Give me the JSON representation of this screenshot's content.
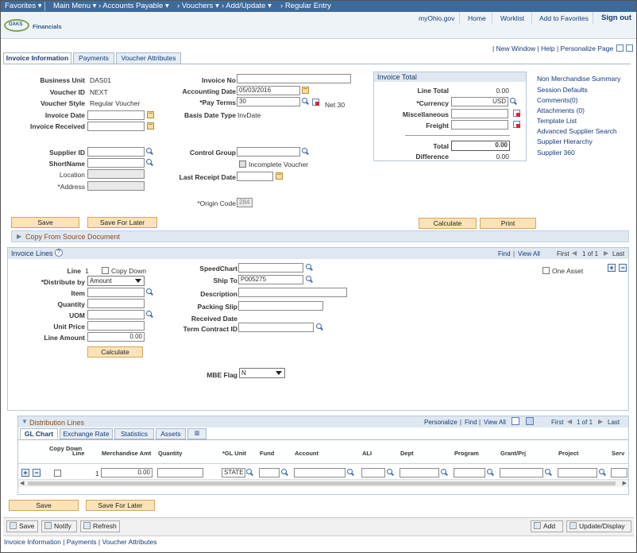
{
  "topnav": {
    "favorites": "Favorites",
    "main_menu": "Main Menu",
    "accounts_payable": "Accounts Payable",
    "vouchers": "Vouchers",
    "add_update": "Add/Update",
    "regular_entry": "Regular Entry"
  },
  "header": {
    "links": [
      "myOhio.gov",
      "Home",
      "Worklist",
      "Add to Favorites",
      "Sign out"
    ],
    "logo_text": "OAKS",
    "logo_sub": "Financials"
  },
  "pagebar": {
    "new_window": "New Window",
    "help": "Help",
    "personalize_page": "Personalize Page"
  },
  "tabs": [
    "Invoice Information",
    "Payments",
    "Voucher Attributes"
  ],
  "header_fields": {
    "business_unit_label": "Business Unit",
    "business_unit": "DAS01",
    "voucher_id_label": "Voucher ID",
    "voucher_id": "NEXT",
    "voucher_style_label": "Voucher Style",
    "voucher_style": "Regular Voucher",
    "invoice_date_label": "Invoice Date",
    "invoice_received_label": "Invoice Received",
    "supplier_id_label": "Supplier ID",
    "shortname_label": "ShortName",
    "location_label": "Location",
    "address_label": "*Address",
    "invoice_no_label": "Invoice No",
    "accounting_date_label": "Accounting Date",
    "accounting_date": "05/03/2016",
    "pay_terms_label": "*Pay Terms",
    "pay_terms": "30",
    "pay_terms_desc": "Net 30",
    "basis_date_type_label": "Basis Date Type",
    "basis_date_type": "InvDate",
    "control_group_label": "Control Group",
    "incomplete_voucher_label": "Incomplete Voucher",
    "last_receipt_date_label": "Last Receipt Date",
    "origin_code_label": "*Origin Code",
    "origin_code": "284"
  },
  "invoice_total": {
    "title": "Invoice Total",
    "line_total_label": "Line Total",
    "line_total": "0.00",
    "currency_label": "*Currency",
    "currency": "USD",
    "misc_label": "Miscellaneous",
    "freight_label": "Freight",
    "total_label": "Total",
    "total": "0.00",
    "difference_label": "Difference",
    "difference": "0.00"
  },
  "side_links": [
    "Non Merchandise Summary",
    "Session Defaults",
    "Comments(0)",
    "Attachments (0)",
    "Template List",
    "Advanced Supplier Search",
    "Supplier Hierarchy",
    "Supplier 360"
  ],
  "buttons": {
    "save": "Save",
    "save_for_later": "Save For Later",
    "calculate": "Calculate",
    "print": "Print"
  },
  "copy_from_source": "Copy From Source Document",
  "invoice_lines": {
    "title": "Invoice Lines",
    "find": "Find",
    "view_all": "View All",
    "first": "First",
    "range": "1 of 1",
    "last": "Last",
    "line_label": "Line",
    "line": "1",
    "copy_down_label": "Copy Down",
    "distribute_by_label": "*Distribute by",
    "distribute_by": "Amount",
    "item_label": "Item",
    "quantity_label": "Quantity",
    "uom_label": "UOM",
    "unit_price_label": "Unit Price",
    "line_amount_label": "Line Amount",
    "line_amount": "0.00",
    "calculate": "Calculate",
    "speedchart_label": "SpeedChart",
    "ship_to_label": "Ship To",
    "ship_to": "P005275",
    "description_label": "Description",
    "packing_slip_label": "Packing Slip",
    "received_date_label": "Received Date",
    "term_contract_label": "Term Contract ID",
    "one_asset_label": "One Asset",
    "mbe_flag_label": "MBE Flag",
    "mbe_flag": "N"
  },
  "distribution": {
    "title": "Distribution Lines",
    "personalize": "Personalize",
    "find": "Find",
    "view_all": "View All",
    "first": "First",
    "range": "1 of 1",
    "last": "Last",
    "tabs": [
      "GL Chart",
      "Exchange Rate",
      "Statistics",
      "Assets"
    ],
    "columns": [
      "Copy Down",
      "Line",
      "Merchandise Amt",
      "Quantity",
      "*GL Unit",
      "Fund",
      "Account",
      "ALI",
      "Dept",
      "Program",
      "Grant/Prj",
      "Project",
      "Serv"
    ],
    "row": {
      "line": "1",
      "merch_amt": "0.00",
      "gl_unit": "STATE"
    }
  },
  "toolbar": {
    "save": "Save",
    "notify": "Notify",
    "refresh": "Refresh",
    "add": "Add",
    "update_display": "Update/Display"
  },
  "footer_links": [
    "Invoice Information",
    "Payments",
    "Voucher Attributes"
  ]
}
